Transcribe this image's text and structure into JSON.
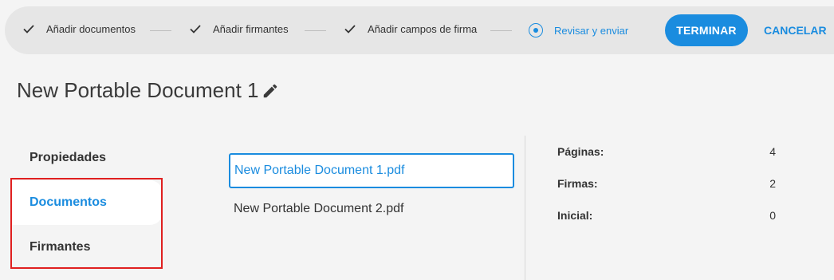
{
  "stepper": {
    "steps": [
      {
        "label": "Añadir documentos",
        "state": "done"
      },
      {
        "label": "Añadir firmantes",
        "state": "done"
      },
      {
        "label": "Añadir campos de firma",
        "state": "done"
      },
      {
        "label": "Revisar y enviar",
        "state": "active"
      }
    ],
    "finish_label": "TERMINAR",
    "cancel_label": "CANCELAR"
  },
  "document": {
    "title": "New Portable Document 1"
  },
  "nav": {
    "items": [
      {
        "label": "Propiedades",
        "active": false
      },
      {
        "label": "Documentos",
        "active": true
      },
      {
        "label": "Firmantes",
        "active": false
      }
    ]
  },
  "documents": [
    {
      "name": "New Portable Document 1.pdf",
      "selected": true
    },
    {
      "name": "New Portable Document 2.pdf",
      "selected": false
    }
  ],
  "properties": [
    {
      "label": "Páginas:",
      "value": "4"
    },
    {
      "label": "Firmas:",
      "value": "2"
    },
    {
      "label": "Inicial:",
      "value": "0"
    }
  ],
  "colors": {
    "accent": "#1a8cdf",
    "highlight": "#e02020"
  },
  "icons": {
    "done": "check-icon",
    "active": "radio-icon",
    "edit": "pencil-icon"
  }
}
